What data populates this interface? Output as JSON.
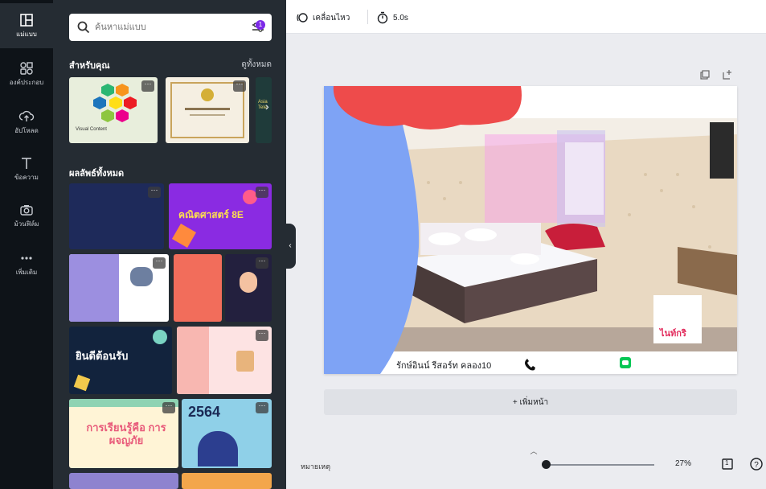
{
  "rail": {
    "items": [
      {
        "label": "แม่แบบ",
        "icon": "template-icon"
      },
      {
        "label": "องค์ประกอบ",
        "icon": "elements-icon"
      },
      {
        "label": "อัปโหลด",
        "icon": "upload-icon"
      },
      {
        "label": "ข้อความ",
        "icon": "text-icon"
      },
      {
        "label": "ม้วนฟิล์ม",
        "icon": "camera-icon"
      },
      {
        "label": "เพิ่มเติม",
        "icon": "more-icon"
      }
    ]
  },
  "panel": {
    "search_placeholder": "ค้นหาแม่แบบ",
    "filter_badge": "1",
    "for_you_title": "สำหรับคุณ",
    "see_all": "ดูทั้งหมด",
    "for_you_thumbs": [
      {
        "caption": "Visual Content",
        "bg": "#e8eedc"
      },
      {
        "caption": "",
        "bg": "#f5efe2"
      },
      {
        "caption": "Asia Tele",
        "bg": "#1f3b3a"
      }
    ],
    "results_title": "ผลลัพธ์ทั้งหมด",
    "result_texts": {
      "math": "คณิตศาสตร์ 8E",
      "welcome": "ยินดีต้อนรับ",
      "learning": "การเรียนรู้คือ การผจญภัย",
      "year": "2564"
    }
  },
  "toolbar": {
    "animate_label": "เคลื่อนไหว",
    "duration_label": "5.0s"
  },
  "canvas": {
    "footer_text": "รักษ์อินน์ รีสอร์ท คลอง10",
    "sign_text": "ไนท์กริ",
    "colors": {
      "blob_red": "#ee4b4b",
      "blob_blue": "#7ea3f5",
      "wall": "#e9d9c2",
      "glow": "#f6a6e8"
    }
  },
  "add_page_label": "+ เพิ่มหน้า",
  "bottom": {
    "notes_label": "หมายเหตุ",
    "zoom_label": "27%",
    "page_count": "1",
    "zoom_fraction": 0.27
  }
}
